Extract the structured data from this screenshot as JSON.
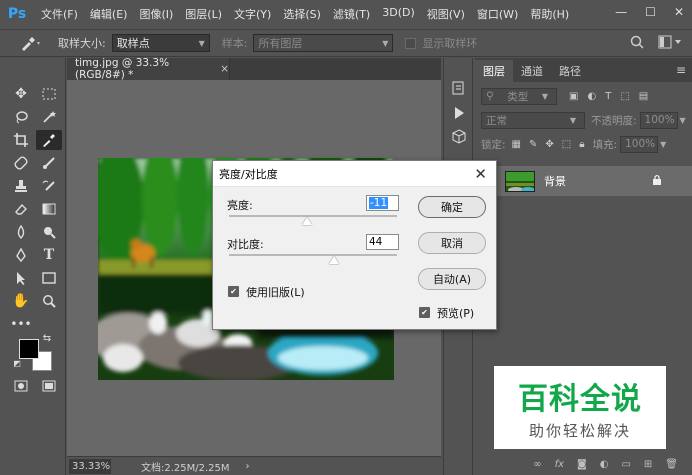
{
  "app": {
    "logo": "Ps"
  },
  "menu": [
    "文件(F)",
    "编辑(E)",
    "图像(I)",
    "图层(L)",
    "文字(Y)",
    "选择(S)",
    "滤镜(T)",
    "3D(D)",
    "视图(V)",
    "窗口(W)",
    "帮助(H)"
  ],
  "window_controls": {
    "minimize": "—",
    "maximize": "☐",
    "close": "✕"
  },
  "options": {
    "sample_size_label": "取样大小:",
    "sample_size_value": "取样点",
    "sample_label": "样本:",
    "sample_value": "所有图层",
    "show_ring_label": "显示取样环"
  },
  "document": {
    "tab_title": "timg.jpg @ 33.3%(RGB/8#) *",
    "close_glyph": "×",
    "zoom": "33.33%",
    "doc_size": "文档:2.25M/2.25M",
    "status_arrow": "›"
  },
  "layers_panel": {
    "tabs": [
      "图层",
      "通道",
      "路径"
    ],
    "active_tab": 0,
    "filter_label": "类型",
    "blend_mode": "正常",
    "opacity_label": "不透明度:",
    "opacity_value": "100%",
    "lock_label": "锁定:",
    "fill_label": "填充:",
    "fill_value": "100%",
    "layer_name": "背景"
  },
  "dialog": {
    "title": "亮度/对比度",
    "brightness_label": "亮度:",
    "brightness_value": "-11",
    "brightness_level": -11,
    "contrast_label": "对比度:",
    "contrast_value": "44",
    "contrast_level": 44,
    "legacy_label": "使用旧版(L)",
    "legacy_checked": true,
    "ok_label": "确定",
    "cancel_label": "取消",
    "auto_label": "自动(A)",
    "preview_label": "预览(P)",
    "preview_checked": true
  },
  "watermark": {
    "title": "百科全说",
    "subtitle": "助你轻松解决"
  },
  "colors": {
    "accent": "#31a8ff",
    "watermark_green": "#12a84a",
    "selection": "#3390ff"
  }
}
